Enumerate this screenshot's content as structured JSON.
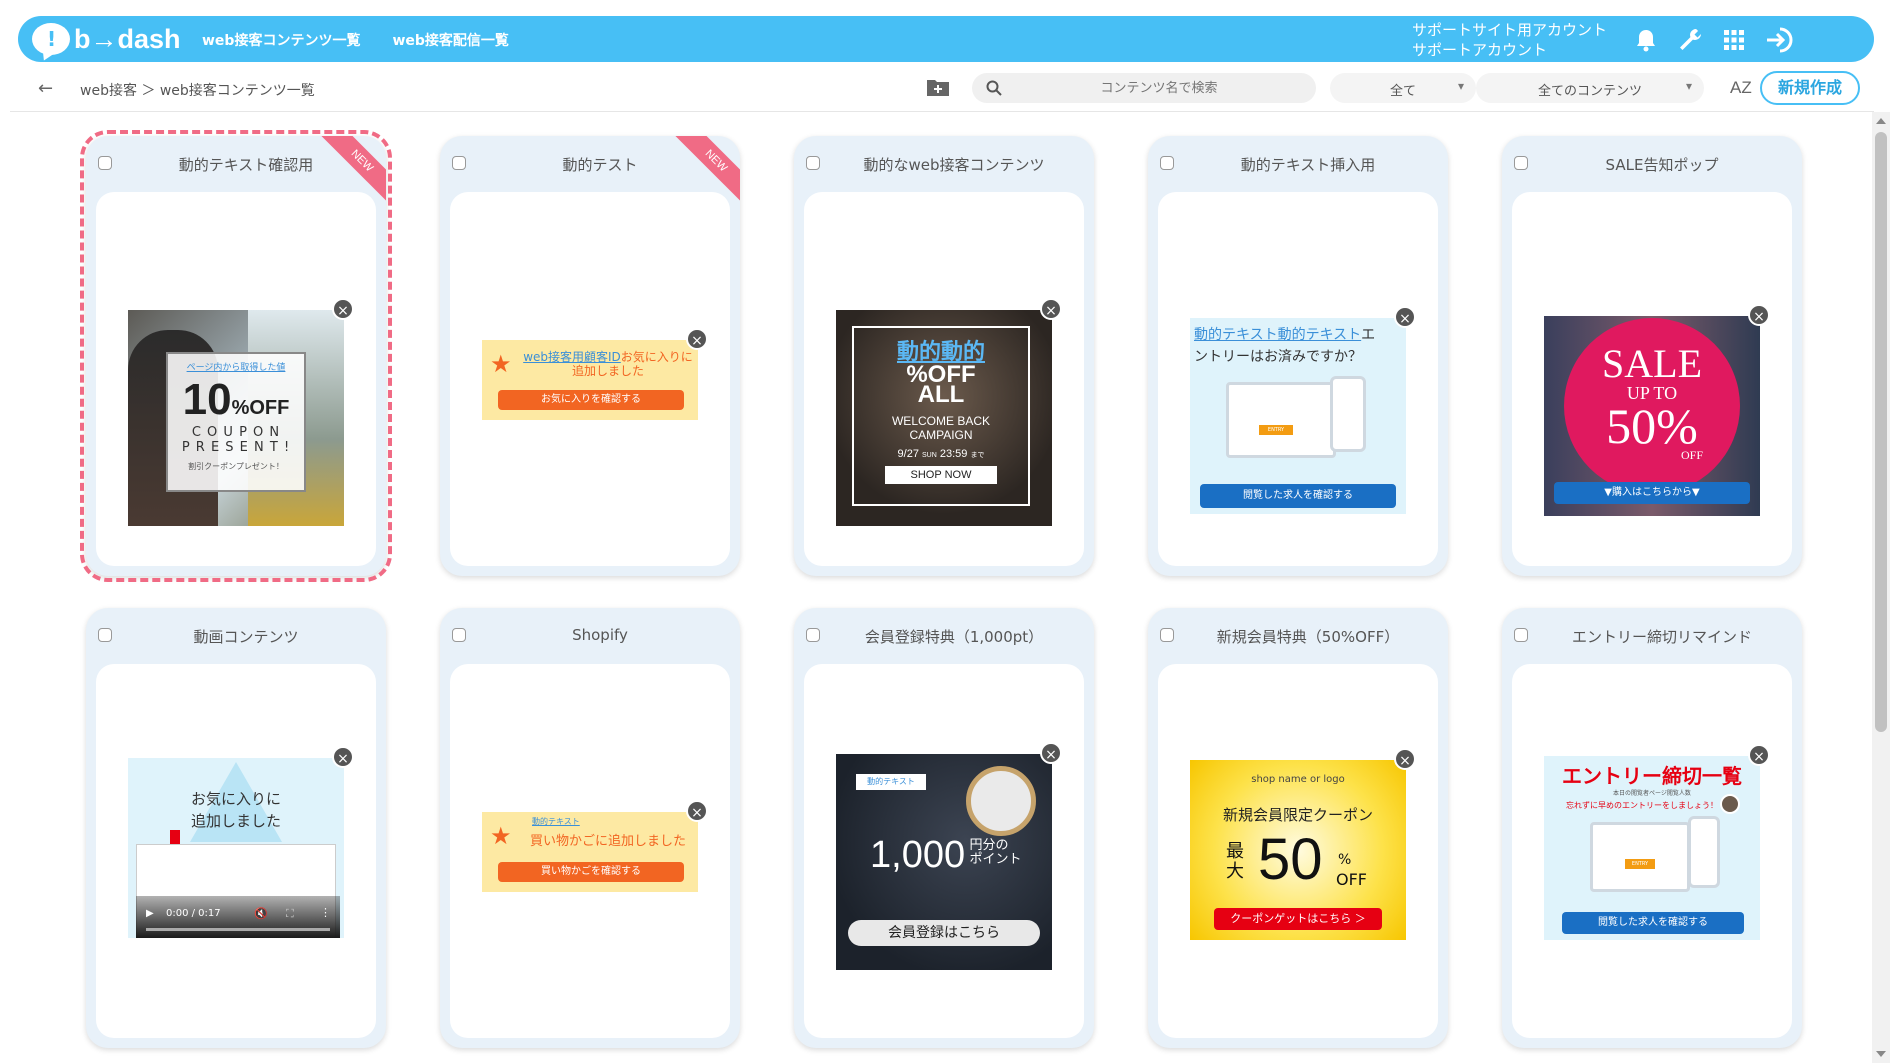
{
  "header": {
    "logo_text": "b→dash",
    "nav": [
      "web接客コンテンツ一覧",
      "web接客配信一覧"
    ],
    "account_line1": "サポートサイト用アカウント",
    "account_line2": "サポートアカウント",
    "icons": [
      "bell-icon",
      "wrench-icon",
      "grid-icon",
      "logout-icon"
    ]
  },
  "toolbar": {
    "breadcrumb": "web接客 ＞ web接客コンテンツ一覧",
    "search_placeholder": "コンテンツ名で検索",
    "filter1": "全て",
    "filter2": "全てのコンテンツ",
    "sort_label": "AZ",
    "new_button": "新規作成"
  },
  "cards": [
    {
      "title": "動的テキスト確認用",
      "badge": "NEW",
      "selected": true
    },
    {
      "title": "動的テスト",
      "badge": "NEW"
    },
    {
      "title": "動的なweb接客コンテンツ"
    },
    {
      "title": "動的テキスト挿入用"
    },
    {
      "title": "SALE告知ポップ"
    },
    {
      "title": "動画コンテンツ"
    },
    {
      "title": "Shopify"
    },
    {
      "title": "会員登録特典（1,000pt）"
    },
    {
      "title": "新規会員特典（50%OFF）"
    },
    {
      "title": "エントリー締切リマインド"
    }
  ],
  "previews": {
    "coupon": {
      "link": "ページ内から取得した値",
      "big": "10",
      "pct": "%OFF",
      "line1": "C O U P O N",
      "line2": "P R E S E N T !",
      "small": "割引クーポンプレゼント！"
    },
    "fav": {
      "link": "web接客用顧客ID",
      "text": "お気に入りに追加しました",
      "btn": "お気に入りを確認する"
    },
    "allsale": {
      "top": "動的動的",
      "pct": "%OFF",
      "all": "ALL",
      "l1": "WELCOME BACK",
      "l2": "CAMPAIGN",
      "date": "9/27",
      "sun": "SUN",
      "time": "23:59",
      "made": "まで",
      "btn": "SHOP NOW"
    },
    "entry": {
      "link": "動的テキスト動的テキスト",
      "text1": "エ",
      "text2": "ントリーはお済みですか？",
      "btn": "閲覧した求人を確認する",
      "label": "ENTRY"
    },
    "sale": {
      "sale": "SALE",
      "upto": "UP TO",
      "num": "50%",
      "off": "OFF",
      "btn": "▼購入はこちらから▼"
    },
    "video": {
      "l1": "お気に入りに",
      "l2": "追加しました",
      "time": "0:00 / 0:17"
    },
    "cart": {
      "link": "動的テキスト",
      "text": "買い物かごに追加しました",
      "btn": "買い物かごを確認する"
    },
    "points": {
      "tag": "動的テキスト",
      "num": "1,000",
      "unit1": "円分の",
      "unit2": "ポイント",
      "btn": "会員登録はこちら"
    },
    "member": {
      "shop": "shop name or logo",
      "title": "新規会員限定クーポン",
      "max1": "最",
      "max2": "大",
      "num": "50",
      "pct": "%",
      "off": "OFF",
      "btn": "クーポンゲットはこちら ＞"
    },
    "deadline": {
      "title": "エントリー締切一覧",
      "sub": "本日の閲覧者ページ閲覧人数",
      "warn": "忘れずに早めのエントリーをしましょう！",
      "btn": "閲覧した求人を確認する",
      "label": "ENTRY"
    }
  },
  "colors": {
    "brand": "#47bff5",
    "accent": "#f06b85",
    "orange": "#f26522",
    "blue": "#1a6fc4"
  }
}
